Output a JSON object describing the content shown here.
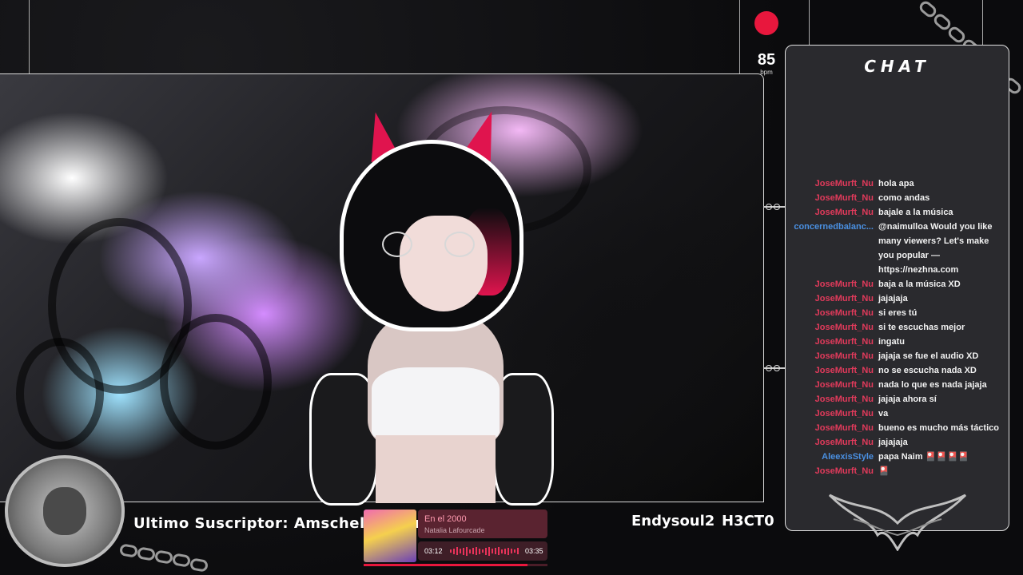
{
  "stream": {
    "bpm_value": "85",
    "bpm_unit": "bpm"
  },
  "chat": {
    "title": "CHAT",
    "messages": [
      {
        "user": "JoseMurft_Nu",
        "text": "hola apa",
        "color": "#e23a5b"
      },
      {
        "user": "JoseMurft_Nu",
        "text": "como andas",
        "color": "#e23a5b"
      },
      {
        "user": "JoseMurft_Nu",
        "text": "bajale a la música",
        "color": "#e23a5b"
      },
      {
        "user": "concernedbalanc...",
        "text": "@naimulloa Would you like many viewers? Let's make you popular — https://nezhna.com",
        "color": "#4a90e2"
      },
      {
        "user": "JoseMurft_Nu",
        "text": "baja a la música XD",
        "color": "#e23a5b"
      },
      {
        "user": "JoseMurft_Nu",
        "text": "jajajaja",
        "color": "#e23a5b"
      },
      {
        "user": "JoseMurft_Nu",
        "text": "si eres tú",
        "color": "#e23a5b"
      },
      {
        "user": "JoseMurft_Nu",
        "text": "si te escuchas mejor",
        "color": "#e23a5b"
      },
      {
        "user": "JoseMurft_Nu",
        "text": "ingatu",
        "color": "#e23a5b"
      },
      {
        "user": "JoseMurft_Nu",
        "text": "jajaja se fue el audio XD",
        "color": "#e23a5b"
      },
      {
        "user": "JoseMurft_Nu",
        "text": "no se escucha nada XD",
        "color": "#e23a5b"
      },
      {
        "user": "JoseMurft_Nu",
        "text": "nada lo que es nada jajaja",
        "color": "#e23a5b"
      },
      {
        "user": "JoseMurft_Nu",
        "text": "jajaja ahora sí",
        "color": "#e23a5b"
      },
      {
        "user": "JoseMurft_Nu",
        "text": "va",
        "color": "#e23a5b"
      },
      {
        "user": "JoseMurft_Nu",
        "text": "bueno es mucho más táctico",
        "color": "#e23a5b"
      },
      {
        "user": "JoseMurft_Nu",
        "text": "jajajaja",
        "color": "#e23a5b"
      },
      {
        "user": "AleexisStyle",
        "text": "papa Naim 🎴🎴🎴🎴",
        "color": "#4a90e2"
      },
      {
        "user": "JoseMurft_Nu",
        "text": "🎴",
        "color": "#e23a5b"
      }
    ]
  },
  "footer": {
    "last_sub_label": "Ultimo Suscriptor: AmschelBathor",
    "name_1": "Endysoul2",
    "name_2": "H3CT0"
  },
  "player": {
    "song": "En el 2000",
    "artist": "Natalia Lafourcade",
    "time_current": "03:12",
    "time_total": "03:35",
    "progress": 0.89
  },
  "colors": {
    "accent": "#e8173d",
    "player_bg": "#5a2330"
  }
}
